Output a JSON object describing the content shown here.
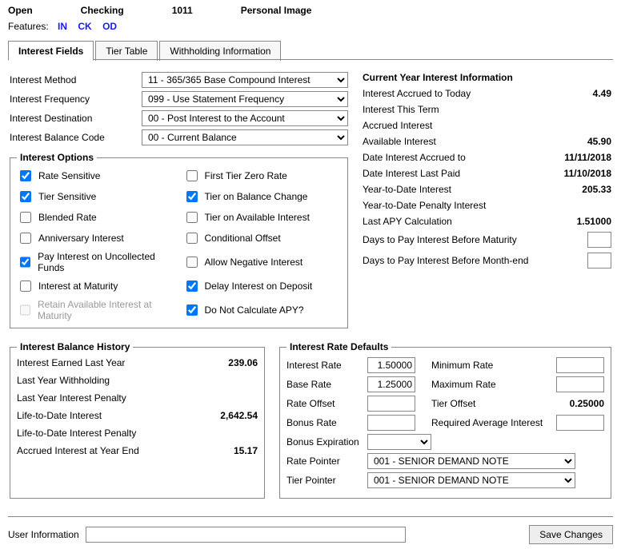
{
  "header": {
    "status": "Open",
    "account_type": "Checking",
    "account_number": "1011",
    "image_label": "Personal Image"
  },
  "features": {
    "label": "Features:",
    "items": [
      "IN",
      "CK",
      "OD"
    ]
  },
  "tabs": {
    "t0": "Interest Fields",
    "t1": "Tier Table",
    "t2": "Withholding Information"
  },
  "fields": {
    "interest_method": {
      "label": "Interest Method",
      "value": "11 - 365/365 Base Compound Interest"
    },
    "interest_frequency": {
      "label": "Interest Frequency",
      "value": "099 - Use Statement Frequency"
    },
    "interest_destination": {
      "label": "Interest Destination",
      "value": "00 - Post Interest to the Account"
    },
    "interest_balance_code": {
      "label": "Interest Balance Code",
      "value": "00 - Current Balance"
    }
  },
  "options": {
    "legend": "Interest Options",
    "rate_sensitive": "Rate Sensitive",
    "first_tier_zero": "First Tier Zero Rate",
    "tier_sensitive": "Tier Sensitive",
    "tier_on_balance_change": "Tier on Balance Change",
    "blended_rate": "Blended Rate",
    "tier_on_available": "Tier on Available Interest",
    "anniversary": "Anniversary Interest",
    "conditional_offset": "Conditional Offset",
    "pay_uncollected": "Pay Interest on Uncollected Funds",
    "allow_negative": "Allow Negative Interest",
    "interest_at_maturity": "Interest at Maturity",
    "delay_on_deposit": "Delay Interest on Deposit",
    "retain_available": "Retain Available Interest at Maturity",
    "do_not_calc_apy": "Do Not Calculate APY?"
  },
  "current_year": {
    "title": "Current Year Interest Information",
    "accrued_today_lbl": "Interest Accrued to Today",
    "accrued_today_val": "4.49",
    "this_term_lbl": "Interest This Term",
    "accrued_interest_lbl": "Accrued Interest",
    "available_interest_lbl": "Available Interest",
    "available_interest_val": "45.90",
    "date_accrued_to_lbl": "Date Interest Accrued to",
    "date_accrued_to_val": "11/11/2018",
    "date_last_paid_lbl": "Date Interest Last Paid",
    "date_last_paid_val": "11/10/2018",
    "ytd_interest_lbl": "Year-to-Date Interest",
    "ytd_interest_val": "205.33",
    "ytd_penalty_lbl": "Year-to-Date Penalty Interest",
    "last_apy_lbl": "Last APY Calculation",
    "last_apy_val": "1.51000",
    "days_before_maturity_lbl": "Days to Pay Interest Before Maturity",
    "days_before_monthend_lbl": "Days to Pay Interest Before Month-end"
  },
  "history": {
    "legend": "Interest Balance History",
    "earned_last_year_lbl": "Interest Earned Last Year",
    "earned_last_year_val": "239.06",
    "last_year_withholding_lbl": "Last Year Withholding",
    "last_year_penalty_lbl": "Last Year Interest Penalty",
    "life_to_date_lbl": "Life-to-Date Interest",
    "life_to_date_val": "2,642.54",
    "life_to_date_penalty_lbl": "Life-to-Date Interest Penalty",
    "accrued_year_end_lbl": "Accrued Interest at Year End",
    "accrued_year_end_val": "15.17"
  },
  "defaults": {
    "legend": "Interest Rate Defaults",
    "interest_rate_lbl": "Interest Rate",
    "interest_rate_val": "1.50000",
    "minimum_rate_lbl": "Minimum Rate",
    "base_rate_lbl": "Base Rate",
    "base_rate_val": "1.25000",
    "maximum_rate_lbl": "Maximum Rate",
    "rate_offset_lbl": "Rate Offset",
    "tier_offset_lbl": "Tier Offset",
    "tier_offset_val": "0.25000",
    "bonus_rate_lbl": "Bonus Rate",
    "req_avg_lbl": "Required Average Interest",
    "bonus_exp_lbl": "Bonus Expiration",
    "rate_pointer_lbl": "Rate Pointer",
    "rate_pointer_val": "001 - SENIOR DEMAND NOTE",
    "tier_pointer_lbl": "Tier Pointer",
    "tier_pointer_val": "001 - SENIOR DEMAND NOTE"
  },
  "bottom": {
    "user_info_lbl": "User Information",
    "save_btn": "Save Changes"
  }
}
